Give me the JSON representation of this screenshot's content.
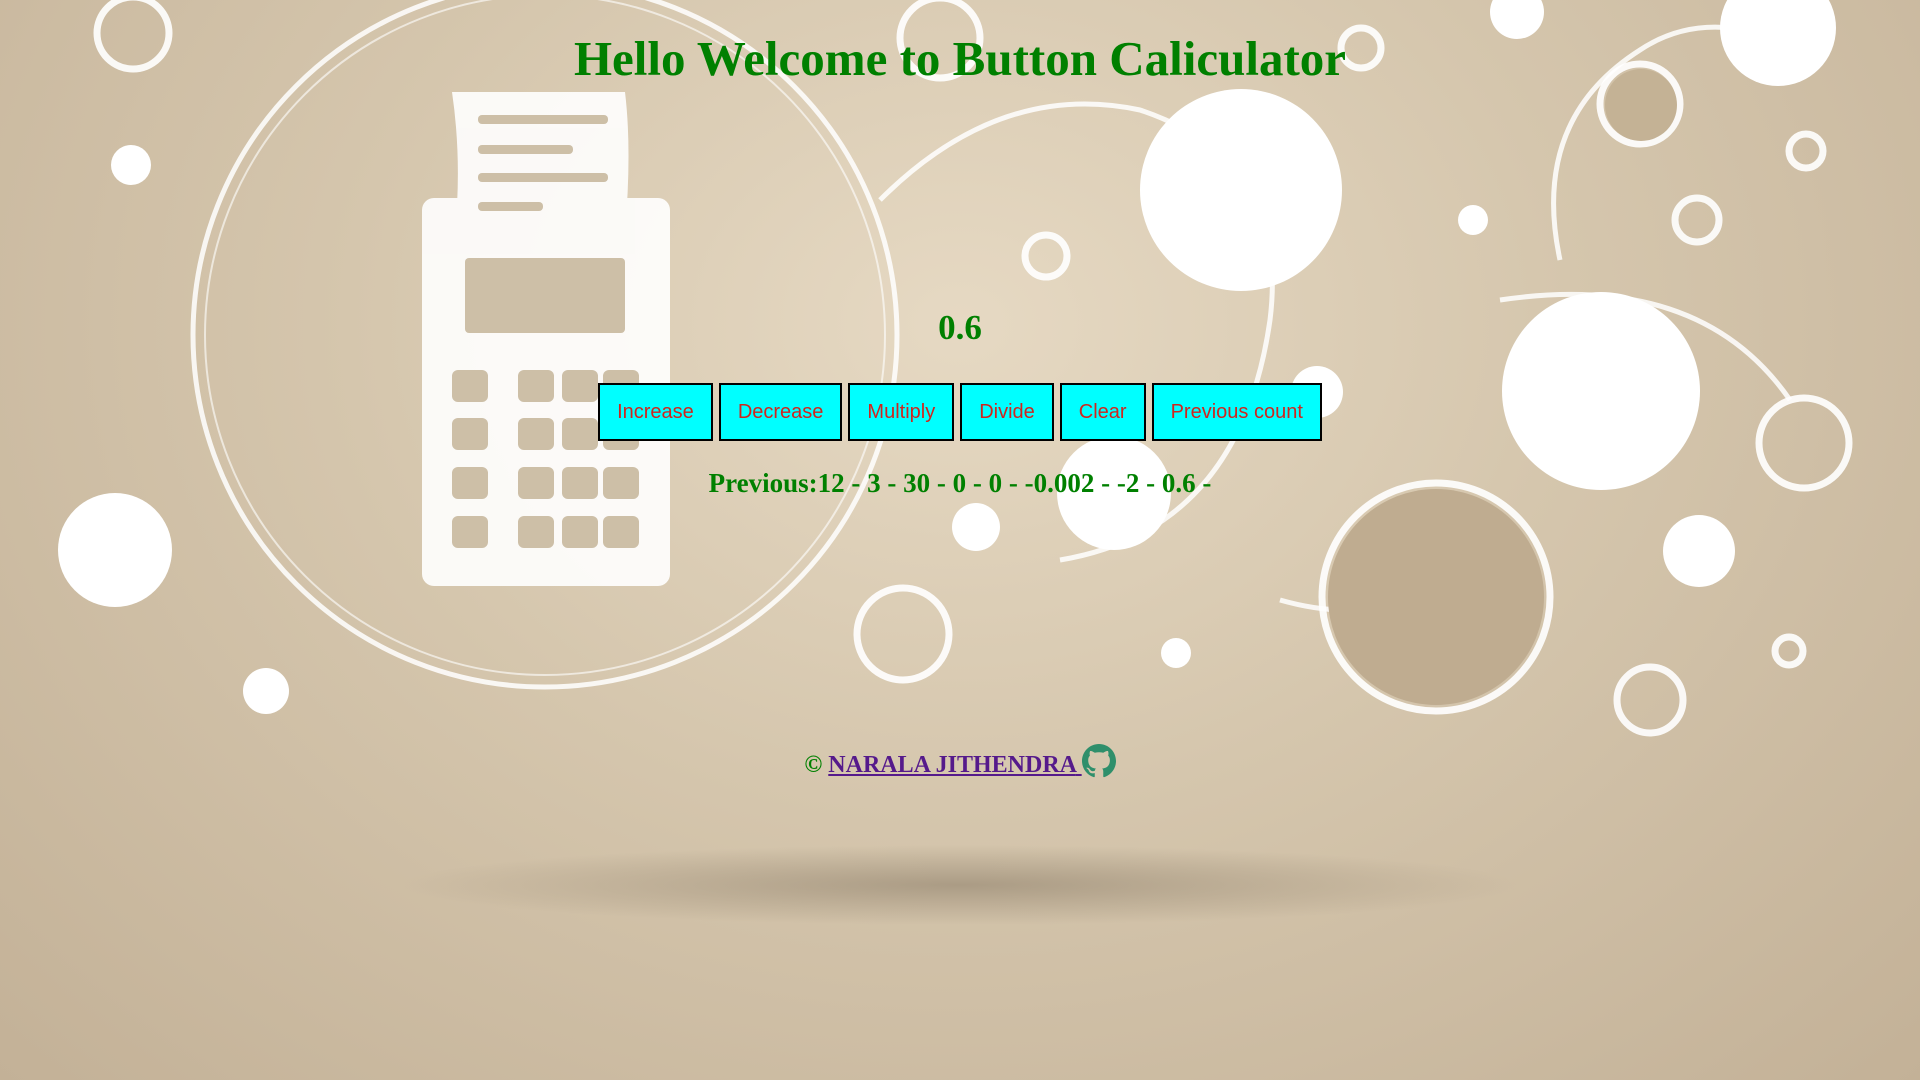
{
  "header": {
    "title": "Hello Welcome to Button Caliculator"
  },
  "counter": {
    "value": "0.6"
  },
  "buttons": {
    "increase": "Increase",
    "decrease": "Decrease",
    "multiply": "Multiply",
    "divide": "Divide",
    "clear": "Clear",
    "previous_count": "Previous count"
  },
  "history": {
    "text": "Previous:12 - 3 - 30 - 0 - 0 - -0.002 - -2 - 0.6 -"
  },
  "footer": {
    "copyright_symbol": "©",
    "author_link": "NARALA JITHENDRA",
    "icon": "github-icon"
  },
  "colors": {
    "heading_green": "#008000",
    "button_bg": "#00ffff",
    "button_text": "#d0251e",
    "link": "#551a8b",
    "background": "#d5c6ad"
  }
}
